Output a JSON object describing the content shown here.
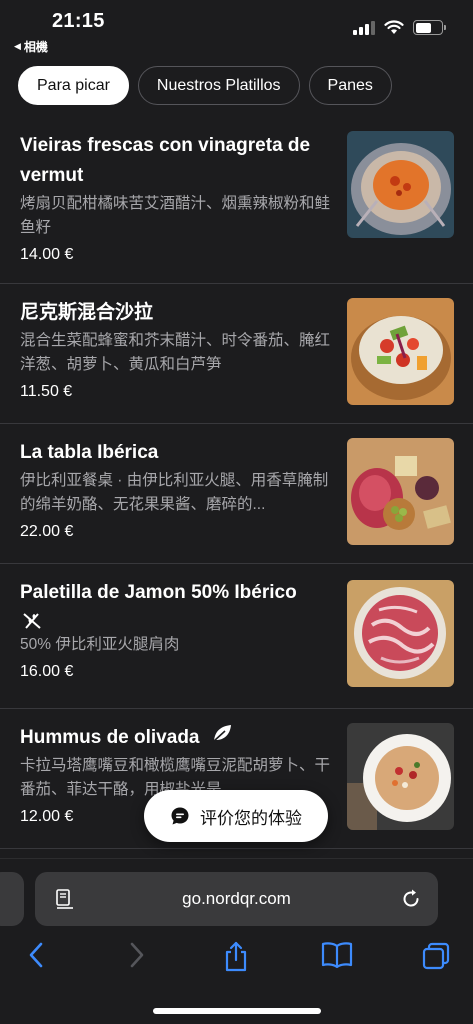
{
  "status_bar": {
    "time": "21:15",
    "back_label": "相機"
  },
  "tabs": [
    {
      "label": "Para picar",
      "active": true
    },
    {
      "label": "Nuestros Platillos",
      "active": false
    },
    {
      "label": "Panes",
      "active": false
    }
  ],
  "menu_items": [
    {
      "name": "Vieiras frescas con vinagreta de vermut",
      "description": "烤扇贝配柑橘味苦艾酒醋汁、烟熏辣椒粉和鲑鱼籽",
      "price": "14.00 €",
      "image": "scallop-photo"
    },
    {
      "name": "尼克斯混合沙拉",
      "description": "混合生菜配蜂蜜和芥末醋汁、时令番茄、腌红洋葱、胡萝卜、黄瓜和白芦笋",
      "price": "11.50 €",
      "image": "salad-photo"
    },
    {
      "name": "La tabla Ibérica",
      "description": "伊比利亚餐桌 · 由伊比利亚火腿、用香草腌制的绵羊奶酪、无花果果酱、磨碎的...",
      "price": "22.00 €",
      "image": "iberian-board-photo"
    },
    {
      "name": "Paletilla de Jamon 50% Ibérico",
      "description": "50% 伊比利亚火腿肩肉",
      "price": "16.00 €",
      "image": "jamon-photo",
      "icon": "gluten-free-icon"
    },
    {
      "name": "Hummus de olivada",
      "description": "卡拉马塔鹰嘴豆和橄榄鹰嘴豆泥配胡萝卜、干番茄、菲达干酪，用椒盐光是...",
      "price": "12.00 €",
      "image": "hummus-photo",
      "icon": "vegan-leaf-icon"
    }
  ],
  "review_pill": {
    "label": "评价您的体验",
    "icon": "chat-bubble-icon"
  },
  "browser": {
    "url": "go.nordqr.com",
    "accent_color": "#3d8bfd"
  }
}
